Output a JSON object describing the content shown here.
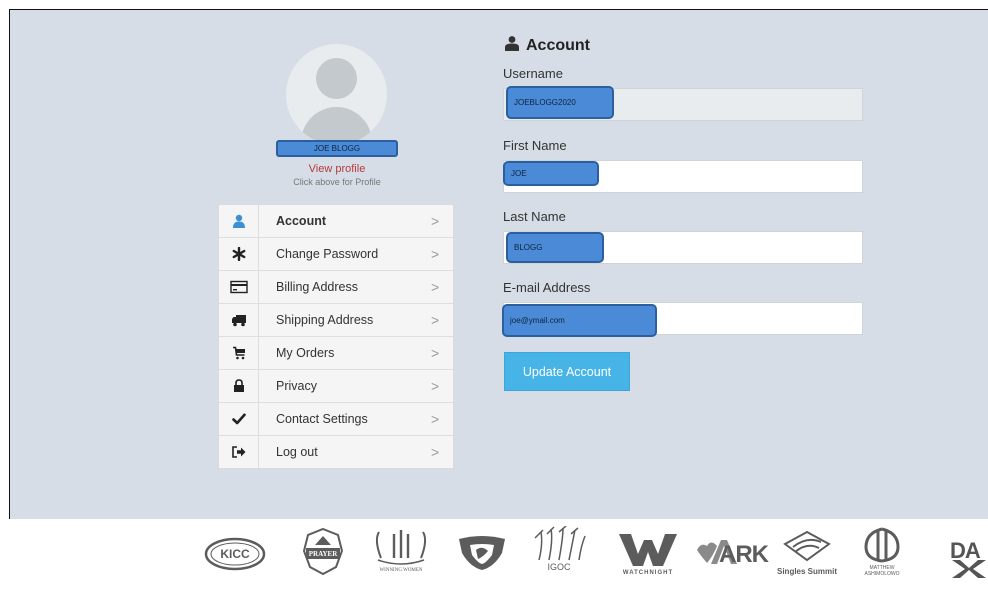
{
  "profile": {
    "name": "JOE BLOGG",
    "view_profile": "View profile",
    "hint": "Click above for Profile"
  },
  "menu": {
    "items": [
      {
        "label": "Account",
        "icon": "user-icon",
        "chevron": ">",
        "active": true
      },
      {
        "label": "Change Password",
        "icon": "asterisk-icon",
        "chevron": ">"
      },
      {
        "label": "Billing Address",
        "icon": "credit-card-icon",
        "chevron": ">"
      },
      {
        "label": "Shipping Address",
        "icon": "truck-icon",
        "chevron": ">"
      },
      {
        "label": "My Orders",
        "icon": "cart-icon",
        "chevron": ">"
      },
      {
        "label": "Privacy",
        "icon": "lock-icon",
        "chevron": ">"
      },
      {
        "label": "Contact Settings",
        "icon": "checkmark-icon",
        "chevron": ">"
      },
      {
        "label": "Log out",
        "icon": "logout-icon",
        "chevron": ">"
      }
    ]
  },
  "account": {
    "title": "Account",
    "username_label": "Username",
    "username_value": "JOEBLOGG2020",
    "first_name_label": "First Name",
    "first_name_value": "JOE",
    "last_name_label": "Last Name",
    "last_name_value": "BLOGG",
    "email_label": "E-mail Address",
    "email_value": "joe@ymail.com",
    "update_button": "Update Account"
  },
  "footer": {
    "logos": {
      "kicc": "KICC",
      "prayer": "PRAYER",
      "winning_women": "WINNING WOMEN",
      "igoc": "IGOC",
      "watchnight": "WATCHNIGHT",
      "ark": "ARK",
      "singles_summit": "Singles Summit",
      "matthew": "MATTHEW ASHIMOLOWO",
      "da": "DA"
    }
  },
  "colors": {
    "background": "#d6dde6",
    "accent_button": "#47b4e8",
    "redaction_fill": "#4a8ad6",
    "link_red": "#b43b3b"
  }
}
